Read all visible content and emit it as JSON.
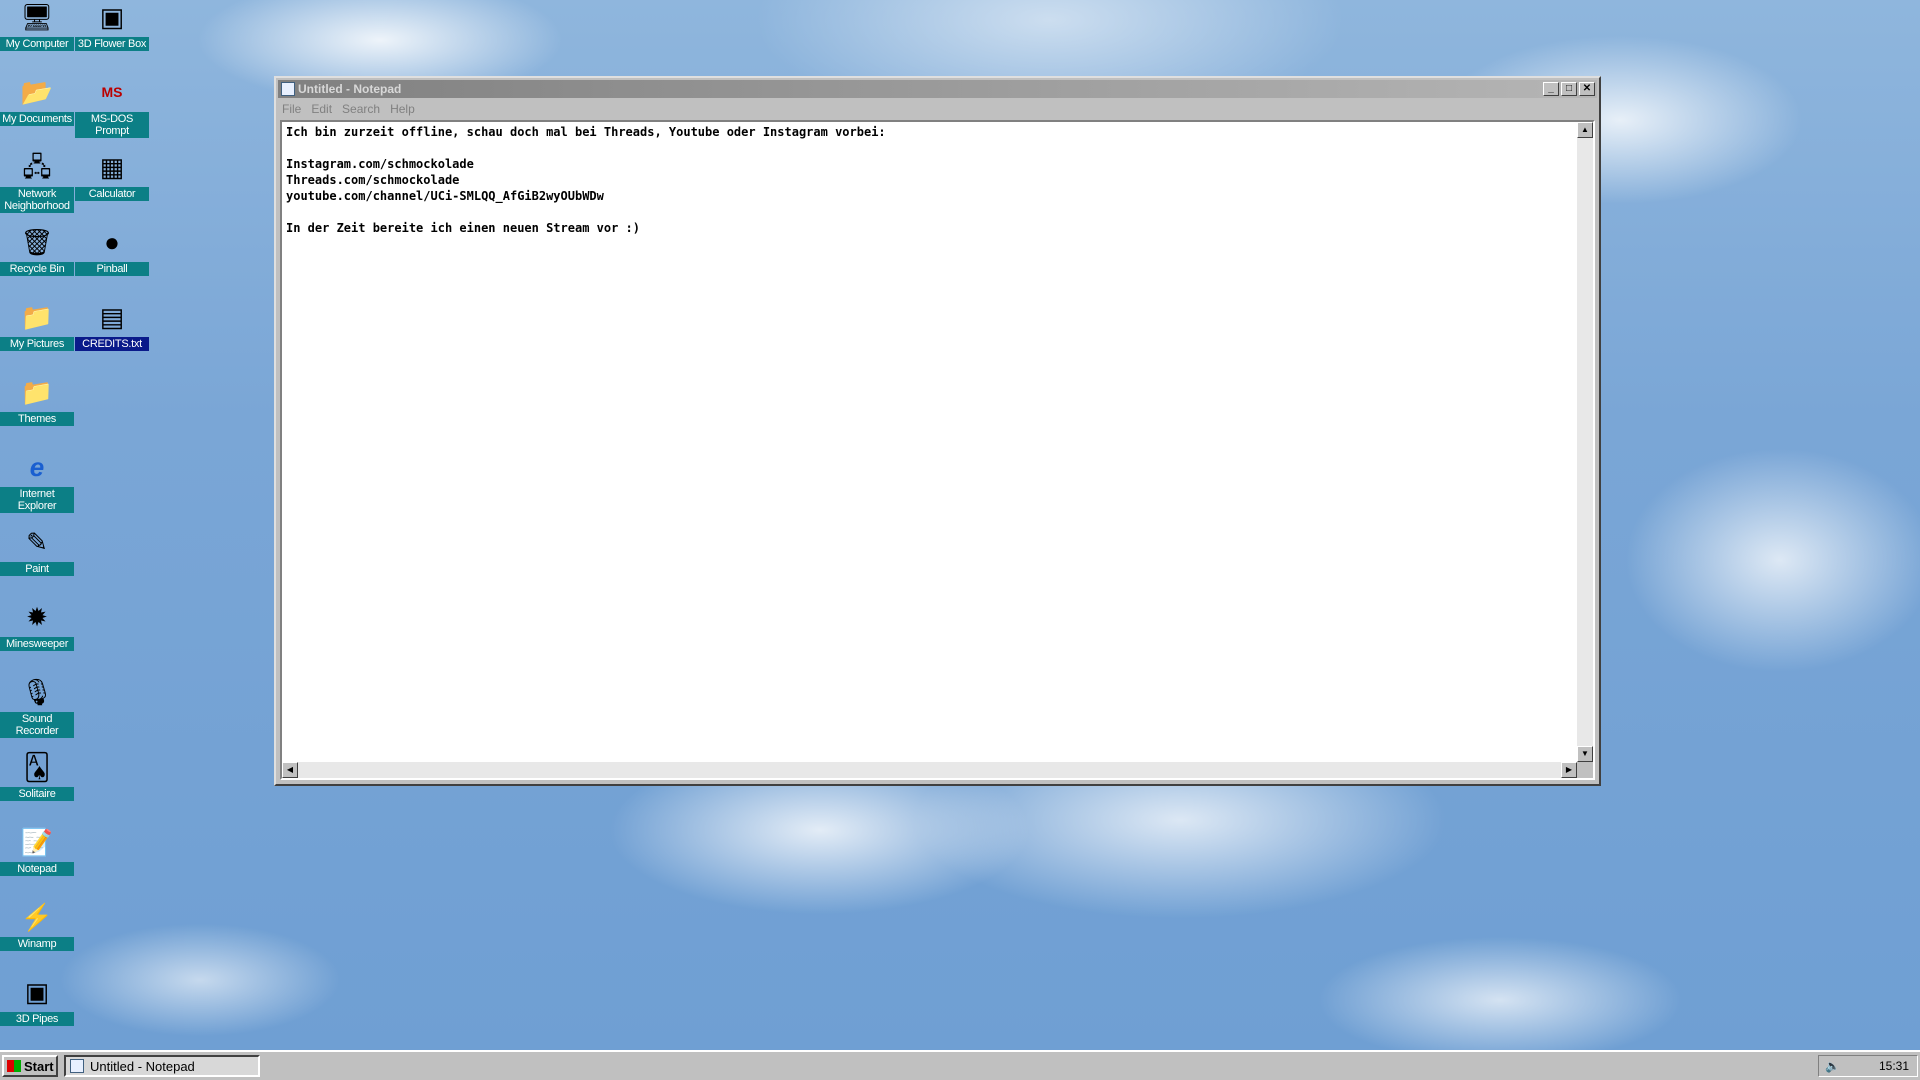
{
  "desktop": {
    "icons": [
      {
        "label": "My Computer",
        "icon": "computer-icon",
        "glyph": "🖥"
      },
      {
        "label": "3D Flower Box",
        "icon": "screensaver-icon",
        "glyph": "▣"
      },
      {
        "label": "My Documents",
        "icon": "folder-documents-icon",
        "glyph": "📂"
      },
      {
        "label": "MS-DOS Prompt",
        "icon": "msdos-icon",
        "glyph": "MS"
      },
      {
        "label": "Network Neighborhood",
        "icon": "network-icon",
        "glyph": "🖧"
      },
      {
        "label": "Calculator",
        "icon": "calculator-icon",
        "glyph": "▦"
      },
      {
        "label": "Recycle Bin",
        "icon": "recycle-bin-icon",
        "glyph": "🗑"
      },
      {
        "label": "Pinball",
        "icon": "pinball-icon",
        "glyph": "●"
      },
      {
        "label": "My Pictures",
        "icon": "folder-icon",
        "glyph": "📁"
      },
      {
        "label": "CREDITS.txt",
        "icon": "text-file-icon",
        "glyph": "▤"
      },
      {
        "label": "Themes",
        "icon": "folder-icon",
        "glyph": "📁"
      },
      {
        "label": "Internet Explorer",
        "icon": "internet-explorer-icon",
        "glyph": "e"
      },
      {
        "label": "Paint",
        "icon": "paint-icon",
        "glyph": "✎"
      },
      {
        "label": "Minesweeper",
        "icon": "minesweeper-icon",
        "glyph": "✹"
      },
      {
        "label": "Sound Recorder",
        "icon": "microphone-icon",
        "glyph": "🎙"
      },
      {
        "label": "Solitaire",
        "icon": "solitaire-icon",
        "glyph": "🂡"
      },
      {
        "label": "Notepad",
        "icon": "notepad-icon",
        "glyph": "📝"
      },
      {
        "label": "Winamp",
        "icon": "winamp-icon",
        "glyph": "⚡"
      },
      {
        "label": "3D Pipes",
        "icon": "screensaver-icon",
        "glyph": "▣"
      }
    ]
  },
  "notepad": {
    "title": "Untitled - Notepad",
    "menu": [
      "File",
      "Edit",
      "Search",
      "Help"
    ],
    "content": "Ich bin zurzeit offline, schau doch mal bei Threads, Youtube oder Instagram vorbei:\n\nInstagram.com/schmockolade\nThreads.com/schmockolade\nyoutube.com/channel/UCi-SMLQQ_AfGiB2wyOUbWDw\n\nIn der Zeit bereite ich einen neuen Stream vor :)"
  },
  "taskbar": {
    "start_label": "Start",
    "task_label": "Untitled - Notepad",
    "clock": "15:31"
  }
}
